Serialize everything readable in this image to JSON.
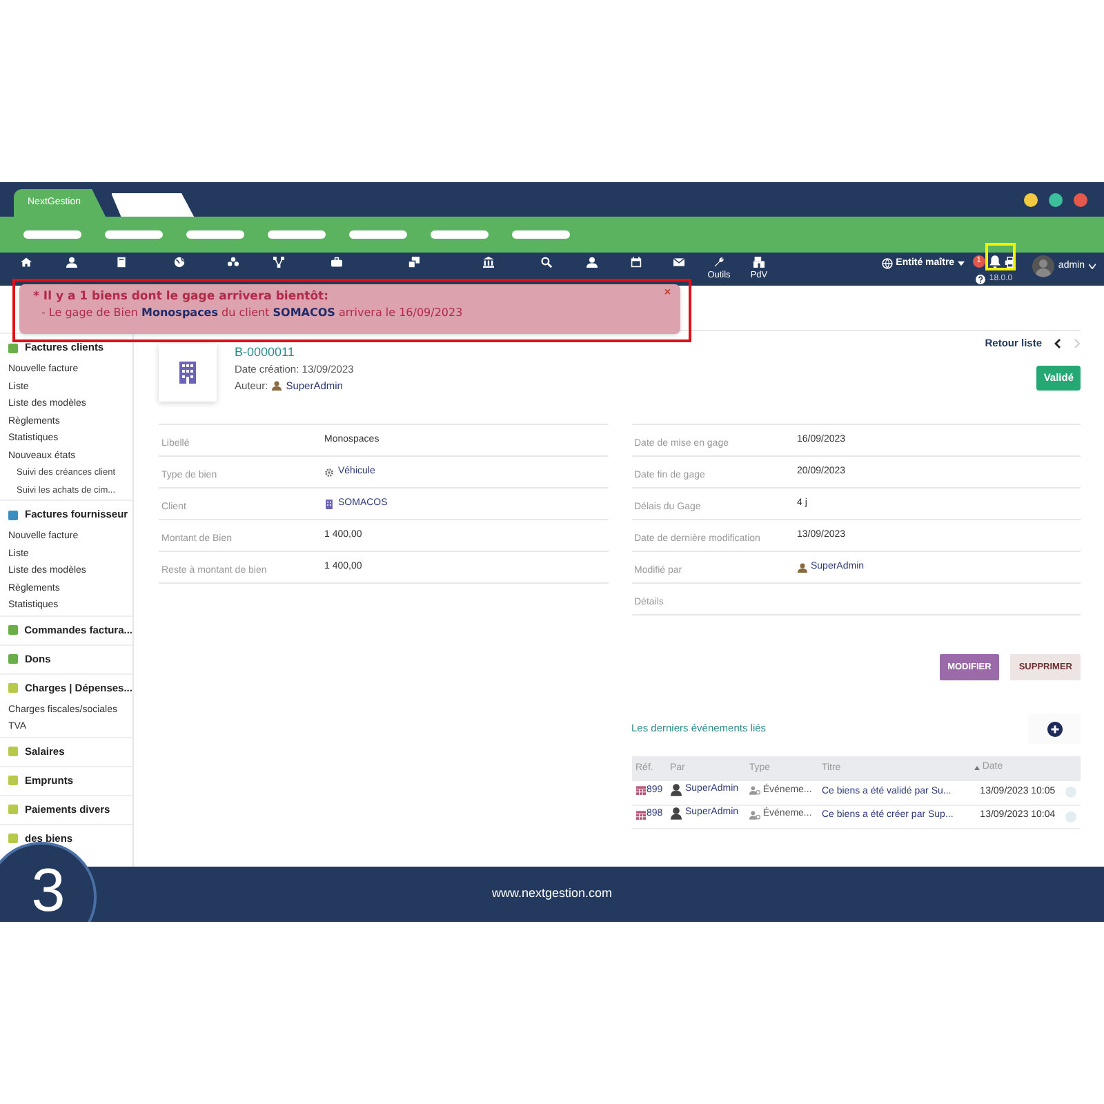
{
  "window": {
    "tab": "NextGestion"
  },
  "nav_items": [
    {
      "kind": "icon_only"
    },
    {
      "kind": "icon_only"
    },
    {
      "kind": "icon_only"
    },
    {
      "kind": "icon_only"
    },
    {
      "kind": "icon_only"
    },
    {
      "kind": "icon_only"
    },
    {
      "kind": "icon_only"
    },
    {
      "kind": "icon_only"
    },
    {
      "kind": "icon_only"
    },
    {
      "kind": "icon_only"
    },
    {
      "kind": "icon_only"
    },
    {
      "kind": "icon_only"
    },
    {
      "kind": "icon_only"
    },
    {
      "kind": "labeled",
      "label": "Outils"
    },
    {
      "kind": "labeled",
      "label": "PdV"
    }
  ],
  "header": {
    "entity": "Entité maître",
    "notification_count": "1",
    "version": "18.0.0",
    "user": "admin"
  },
  "alert": {
    "title": "* Il y a 1 biens dont le gage arrivera bientôt:",
    "message": "- Le gage de Bien **Monospaces** du client **SOMACOS** arrivera le 16/09/2023",
    "close": "×"
  },
  "sidebar": {
    "items": [
      {
        "kind": "section",
        "label": "Factures clients"
      },
      {
        "kind": "link",
        "label": "Nouvelle facture"
      },
      {
        "kind": "link",
        "label": "Liste"
      },
      {
        "kind": "link",
        "label": "Liste des modèles"
      },
      {
        "kind": "link",
        "label": "Règlements"
      },
      {
        "kind": "link",
        "label": "Statistiques"
      },
      {
        "kind": "link",
        "label": "Nouveaux états"
      },
      {
        "kind": "sublink",
        "label": "Suivi des créances client"
      },
      {
        "kind": "sublink",
        "label": "Suivi les achats de cim..."
      },
      {
        "kind": "section",
        "label": "Factures fournisseur"
      },
      {
        "kind": "link",
        "label": "Nouvelle facture"
      },
      {
        "kind": "link",
        "label": "Liste"
      },
      {
        "kind": "link",
        "label": "Liste des modèles"
      },
      {
        "kind": "link",
        "label": "Règlements"
      },
      {
        "kind": "link",
        "label": "Statistiques"
      },
      {
        "kind": "section",
        "label": "Commandes factura..."
      },
      {
        "kind": "section",
        "label": "Dons"
      },
      {
        "kind": "section",
        "label": "Charges | Dépenses..."
      },
      {
        "kind": "link",
        "label": "Charges fiscales/sociales"
      },
      {
        "kind": "link",
        "label": "TVA"
      },
      {
        "kind": "section",
        "label": "Salaires"
      },
      {
        "kind": "section",
        "label": "Emprunts"
      },
      {
        "kind": "section",
        "label": "Paiements divers"
      },
      {
        "kind": "section",
        "label": "des biens"
      }
    ]
  },
  "record": {
    "ref": "B-0000011",
    "created": "Date création: 13/09/2023",
    "author_label": "Auteur:",
    "author": "SuperAdmin",
    "back": "Retour liste",
    "status": "Validé",
    "left_fields": [
      {
        "label": "Libellé",
        "value": "Monospaces",
        "kind": "text"
      },
      {
        "label": "Type de bien",
        "value": "Véhicule",
        "kind": "gear_link"
      },
      {
        "label": "Client",
        "value": "SOMACOS",
        "kind": "building_link"
      },
      {
        "label": "Montant de Bien",
        "value": "1 400,00",
        "kind": "text"
      },
      {
        "label": "Reste à montant de bien",
        "value": "1 400,00",
        "kind": "text"
      }
    ],
    "right_fields": [
      {
        "label": "Date de mise en gage",
        "value": "16/09/2023",
        "kind": "text"
      },
      {
        "label": "Date fin de gage",
        "value": "20/09/2023",
        "kind": "text"
      },
      {
        "label": "Délais du Gage",
        "value": "4 j",
        "kind": "text"
      },
      {
        "label": "Date de dernière modification",
        "value": "13/09/2023",
        "kind": "text"
      },
      {
        "label": "Modifié par",
        "value": "SuperAdmin",
        "kind": "user_link"
      },
      {
        "label": "Détails",
        "kind": "text"
      }
    ],
    "buttons": [
      "MODIFIER",
      "SUPPRIMER"
    ]
  },
  "events": {
    "title": "Les derniers événements liés",
    "columns": [
      "Réf.",
      "Par",
      "Type",
      "Titre",
      "Date"
    ],
    "rows": [
      {
        "ref": "899",
        "by": "SuperAdmin",
        "type": "Événeme...",
        "title": "Ce biens a été validé par Su...",
        "date": "13/09/2023 10:05"
      },
      {
        "ref": "898",
        "by": "SuperAdmin",
        "type": "Événeme...",
        "title": "Ce biens a été créer par Sup...",
        "date": "13/09/2023 10:04"
      }
    ]
  },
  "footer": {
    "url": "www.nextgestion.com",
    "step": "3"
  }
}
